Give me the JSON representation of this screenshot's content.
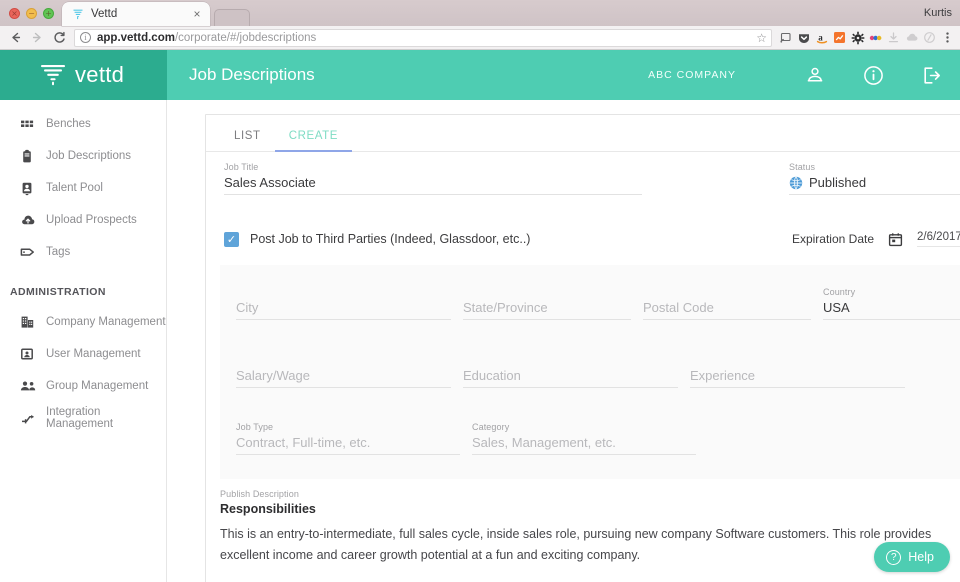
{
  "browser": {
    "tab": {
      "title": "Vettd",
      "favicon": "vettd-logo-icon",
      "close": "×"
    },
    "nav": {
      "back": "←",
      "forward": "→",
      "reload": "C"
    },
    "omnibox": {
      "info_icon": "info-icon",
      "url_bold": "app.vettd.com",
      "url_rest": "/corporate/#/jobdescriptions",
      "star": "☆"
    },
    "extensions": [
      {
        "name": "cast-icon",
        "glyph": "❐"
      },
      {
        "name": "pocket-icon",
        "glyph": "⬟"
      },
      {
        "name": "amazon-icon",
        "glyph": "a"
      },
      {
        "name": "chart-extension-icon",
        "glyph": "↗"
      },
      {
        "name": "gear-icon",
        "glyph": "⚙"
      },
      {
        "name": "colorful-extension-icon",
        "glyph": "•••"
      },
      {
        "name": "download-extension-icon",
        "glyph": "⤓"
      },
      {
        "name": "cloud-extension-icon",
        "glyph": "☁"
      },
      {
        "name": "slash-extension-icon",
        "glyph": "⊘"
      },
      {
        "name": "browser-menu-icon",
        "glyph": "⋮"
      }
    ],
    "profile_name": "Kurtis"
  },
  "header": {
    "logo_text": "vettd",
    "logo_icon": "vettd-funnel-icon",
    "page_title": "Job Descriptions",
    "company": "ABC COMPANY",
    "icons": [
      {
        "name": "user-account-icon"
      },
      {
        "name": "info-icon"
      },
      {
        "name": "logout-icon"
      }
    ]
  },
  "sidebar": {
    "items": [
      {
        "label": "Benches",
        "icon": "grid-icon"
      },
      {
        "label": "Job Descriptions",
        "icon": "clipboard-icon"
      },
      {
        "label": "Talent Pool",
        "icon": "contact-card-icon"
      },
      {
        "label": "Upload Prospects",
        "icon": "cloud-upload-icon"
      },
      {
        "label": "Tags",
        "icon": "tag-icon"
      }
    ],
    "section_label": "ADMINISTRATION",
    "admin_items": [
      {
        "label": "Company Management",
        "icon": "building-icon"
      },
      {
        "label": "User Management",
        "icon": "user-box-icon"
      },
      {
        "label": "Group Management",
        "icon": "group-icon"
      },
      {
        "label": "Integration Management",
        "icon": "integration-icon"
      }
    ]
  },
  "main": {
    "tabs": [
      {
        "label": "LIST",
        "active": false
      },
      {
        "label": "CREATE",
        "active": true
      }
    ],
    "job_title": {
      "label": "Job Title",
      "value": "Sales Associate"
    },
    "status": {
      "label": "Status",
      "value": "Published",
      "icon": "globe-icon",
      "caret": "▼"
    },
    "post_third_parties": {
      "label": "Post Job to Third Parties (Indeed, Glassdoor, etc..)",
      "checked": true,
      "check_glyph": "✓"
    },
    "expiration": {
      "label": "Expiration Date",
      "value": "2/6/2017",
      "calendar_icon": "calendar-icon",
      "caret": "▾"
    },
    "location_row": [
      {
        "label": "",
        "placeholder": "City",
        "value": ""
      },
      {
        "label": "",
        "placeholder": "State/Province",
        "value": ""
      },
      {
        "label": "",
        "placeholder": "Postal Code",
        "value": ""
      },
      {
        "label": "Country",
        "placeholder": "",
        "value": "USA"
      }
    ],
    "comp_row": [
      {
        "label": "",
        "placeholder": "Salary/Wage",
        "value": ""
      },
      {
        "label": "",
        "placeholder": "Education",
        "value": ""
      },
      {
        "label": "",
        "placeholder": "Experience",
        "value": ""
      }
    ],
    "type_row": [
      {
        "label": "Job Type",
        "placeholder": "Contract, Full-time, etc.",
        "value": ""
      },
      {
        "label": "Category",
        "placeholder": "Sales, Management, etc.",
        "value": ""
      }
    ],
    "publish_description": {
      "label": "Publish Description",
      "value": "Responsibilities"
    },
    "description_body": "This is an entry-to-intermediate, full sales cycle, inside sales role, pursuing new company Software customers. This role provides excellent income and career growth potential at a fun and exciting company."
  },
  "help_widget": {
    "label": "Help",
    "icon": "question-circle-icon"
  },
  "colors": {
    "brand_teal": "#4ecdb2",
    "brand_teal_dark": "#2cac8f",
    "tab_active": "#7fdcc4",
    "tab_underline": "#8fa6e8",
    "checkbox_blue": "#5fa4d9",
    "panel_grey": "#fafafa"
  }
}
